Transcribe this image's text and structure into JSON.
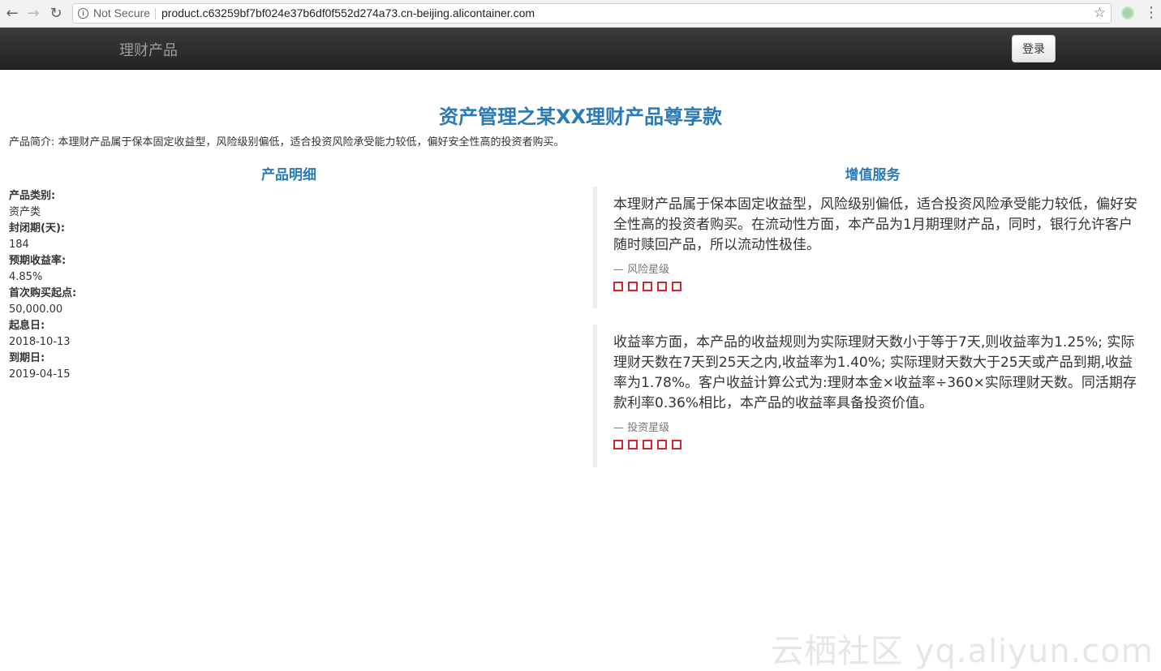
{
  "browser": {
    "security_label": "Not Secure",
    "url": "product.c63259bf7bf024e37b6df0f552d274a73.cn-beijing.alicontainer.com"
  },
  "navbar": {
    "brand": "理财产品",
    "login_label": "登录"
  },
  "page": {
    "title": "资产管理之某XX理财产品尊享款",
    "intro": "产品简介: 本理财产品属于保本固定收益型，风险级别偏低，适合投资风险承受能力较低，偏好安全性高的投资者购买。"
  },
  "details": {
    "heading": "产品明细",
    "items": [
      {
        "label": "产品类别:",
        "value": "资产类"
      },
      {
        "label": "封闭期(天):",
        "value": "184"
      },
      {
        "label": "预期收益率:",
        "value": "4.85%"
      },
      {
        "label": "首次购买起点:",
        "value": "50,000.00"
      },
      {
        "label": "起息日:",
        "value": "2018-10-13"
      },
      {
        "label": "到期日:",
        "value": "2019-04-15"
      }
    ]
  },
  "services": {
    "heading": "增值服务",
    "quotes": [
      {
        "text": "本理财产品属于保本固定收益型，风险级别偏低，适合投资风险承受能力较低，偏好安全性高的投资者购买。在流动性方面，本产品为1月期理财产品，同时，银行允许客户随时赎回产品，所以流动性极佳。",
        "footer": "— 风险星级",
        "stars": 5
      },
      {
        "text": "收益率方面，本产品的收益规则为实际理财天数小于等于7天,则收益率为1.25%; 实际理财天数在7天到25天之内,收益率为1.40%; 实际理财天数大于25天或产品到期,收益率为1.78%。客户收益计算公式为:理财本金×收益率÷360×实际理财天数。同活期存款利率0.36%相比，本产品的收益率具备投资价值。",
        "footer": "— 投资星级",
        "stars": 5
      }
    ]
  },
  "watermark": "云栖社区 yq.aliyun.com",
  "colors": {
    "accent": "#2a7ab5",
    "star_outline": "#d9262f",
    "navbar": "#222222"
  }
}
